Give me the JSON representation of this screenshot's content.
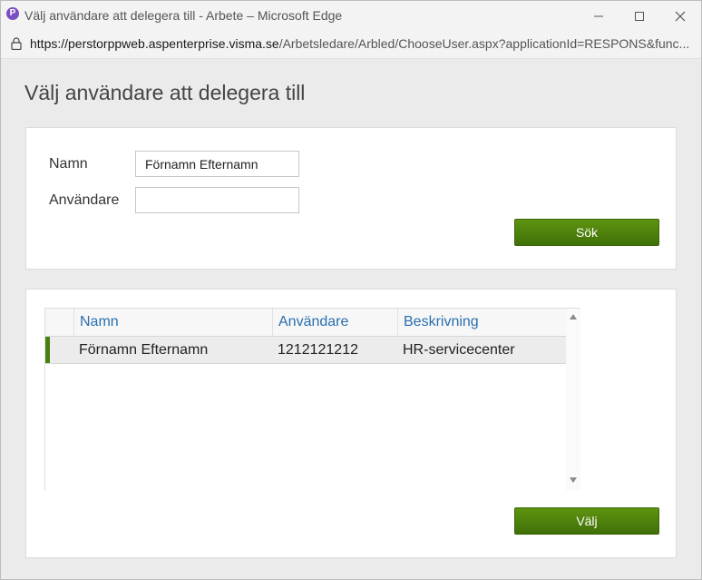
{
  "window": {
    "title": "Välj användare att delegera till - Arbete – Microsoft Edge",
    "app_icon_letter": "P",
    "url_host": "https://perstorppweb.aspenterprise.visma.se",
    "url_path": "/Arbetsledare/Arbled/ChooseUser.aspx?applicationId=RESPONS&func..."
  },
  "page": {
    "title": "Välj användare att delegera till"
  },
  "search": {
    "name_label": "Namn",
    "name_value": "Förnamn Efternamn",
    "user_label": "Användare",
    "user_value": "",
    "search_button": "Sök"
  },
  "results": {
    "columns": [
      "Namn",
      "Användare",
      "Beskrivning"
    ],
    "rows": [
      {
        "name": "Förnamn Efternamn",
        "user": "1212121212",
        "description": "HR-servicecenter"
      }
    ],
    "select_button": "Välj"
  },
  "colors": {
    "button_green": "#4b7e12",
    "header_link_blue": "#2a6fae",
    "selection_marker": "#4b7e12"
  }
}
